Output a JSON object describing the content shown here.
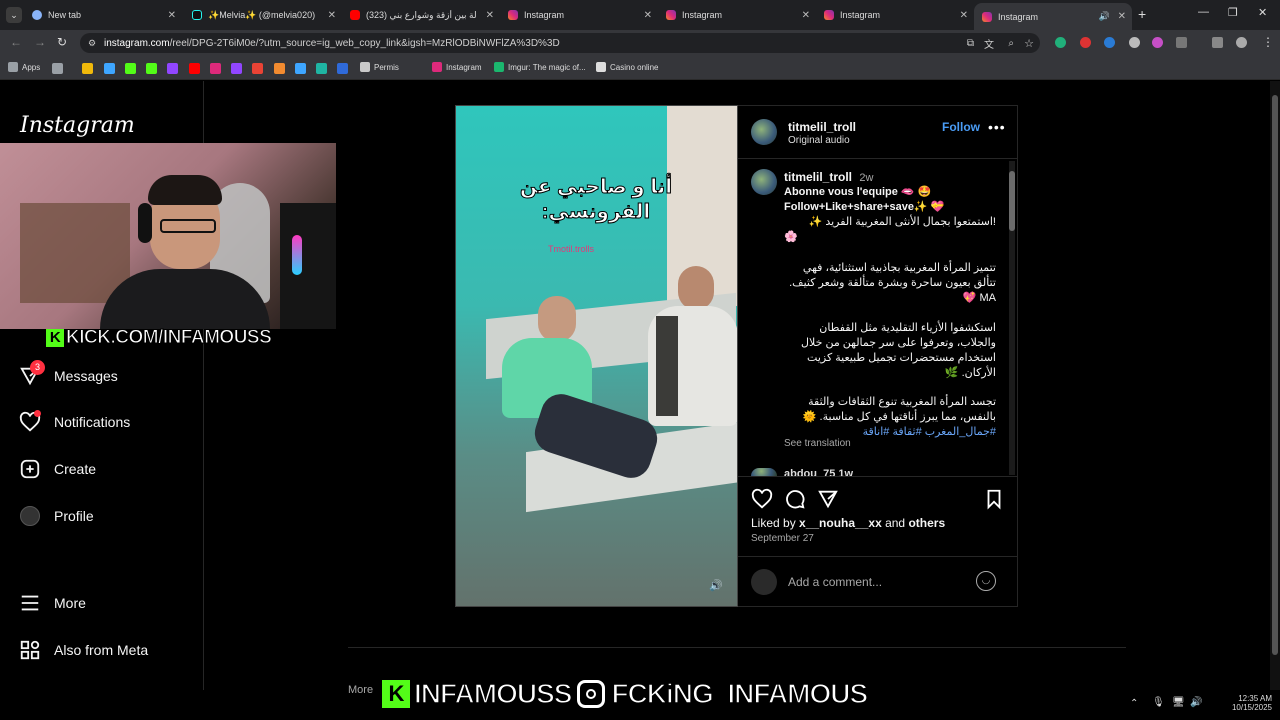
{
  "tabs": [
    {
      "title": "New tab",
      "color": "#8ab4f8"
    },
    {
      "title": "✨Melvia✨ (@melvia020) | Ti",
      "color": "#000000"
    },
    {
      "title": "(323) جولة بين أزقة وشوارع بني",
      "color": "#ff0000"
    },
    {
      "title": "Instagram",
      "color": "#e1306c"
    },
    {
      "title": "Instagram",
      "color": "#e1306c"
    },
    {
      "title": "Instagram",
      "color": "#e1306c"
    },
    {
      "title": "Instagram",
      "color": "#e1306c"
    }
  ],
  "url": {
    "host": "instagram.com",
    "path": "/reel/DPG-2T6iM0e/?utm_source=ig_web_copy_link&igsh=MzRlODBiNWFlZA%3D%3D"
  },
  "bookmarks": {
    "apps": "Apps",
    "permis": "Permis",
    "instagram": "Instagram",
    "imgur": "Imgur: The magic of...",
    "casino": "Casino online"
  },
  "sidebar": {
    "logo": "Instagram",
    "messages": "Messages",
    "messages_badge": "3",
    "notifications": "Notifications",
    "create": "Create",
    "profile": "Profile",
    "more": "More",
    "meta": "Also from Meta"
  },
  "webcam_badge": "KICK.COM/INFAMOUSS",
  "video": {
    "caption_overlay": "أنا و صاحبي عن الفرونسي:",
    "watermark": "Tmotil.trolls"
  },
  "post": {
    "username": "titmelil_troll",
    "follow": "Follow",
    "audio": "Original audio",
    "age": "2w",
    "caption_line1": "Abonne vous l'equipe 🫦 🤩",
    "caption_line2": "Follow+Like+share+save✨ 💝",
    "caption_line3": "!استمتعوا بجمال الأنثى المغربية الفريد ✨",
    "caption_line4": "🌸",
    "para1": "تتميز المرأة المغربية بجاذبية استثنائية، فهي تتألق بعيون ساحرة وبشرة متألقة وشعر كثيف. MA 💖",
    "para2": "استكشفوا الأزياء التقليدية مثل القفطان والجلاب، وتعرفوا على سر جمالهن من خلال استخدام مستحضرات تجميل طبيعية كزيت الأركان. 🌿",
    "para3": "تجسد المرأة المغربية تنوع الثقافات والثقة بالنفس، مما يبرز أناقتها في كل مناسبة. 🌞",
    "hashtags": "#جمال_المغرب #ثقافة #اناقة",
    "see_translation": "See translation",
    "next_comment": "abdou_75  1w",
    "liked_prefix": "Liked by ",
    "liked_user": "x__nouha__xx",
    "liked_and": " and ",
    "liked_others": "others",
    "date": "September 27",
    "comment_placeholder": "Add a comment..."
  },
  "below_text": "More",
  "overlay": {
    "kick": "INFAMOUSS",
    "insta": "FCKiNG_INFAMOUS"
  },
  "clock": {
    "time": "12:35 AM",
    "date": "10/15/2025"
  }
}
